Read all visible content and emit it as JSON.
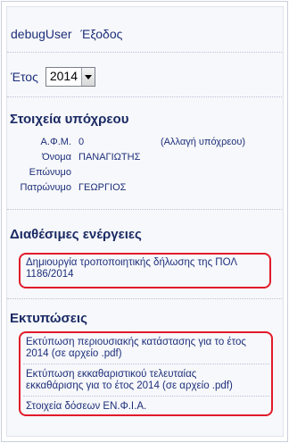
{
  "header": {
    "username": "debugUser",
    "logout_label": "Έξοδος"
  },
  "year": {
    "label": "Έτος",
    "selected": "2014"
  },
  "taxpayer": {
    "title": "Στοιχεία υπόχρεου",
    "afm_label": "Α.Φ.Μ.",
    "afm_value": "0",
    "change_label": "(Αλλαγή υπόχρεου)",
    "name_label": "Όνομα",
    "name_value": "ΠΑΝΑΓΙΩΤΗΣ",
    "surname_label": "Επώνυμο",
    "surname_value": "",
    "father_label": "Πατρώνυμο",
    "father_value": "ΓΕΩΡΓΙΟΣ"
  },
  "actions": {
    "title": "Διαθέσιμες ενέργειες",
    "items": [
      {
        "line1": "Δημιουργία τροποποιητικής δήλωσης της ΠΟΛ",
        "line2": "1186/2014"
      }
    ]
  },
  "prints": {
    "title": "Εκτυπώσεις",
    "items": [
      {
        "line1": "Εκτύπωση περιουσιακής κατάστασης για το έτος",
        "line2": "2014 (σε αρχείο .pdf)"
      },
      {
        "line1": "Εκτύπωση εκκαθαριστικού τελευταίας",
        "line2": "εκκαθάρισης για το έτος 2014 (σε αρχείο .pdf)"
      },
      {
        "line1": "Στοιχεία δόσεων ΕΝ.Φ.Ι.Α.",
        "line2": ""
      }
    ]
  },
  "colors": {
    "link": "#1d2f7a",
    "highlight_border": "#e11b2a"
  }
}
